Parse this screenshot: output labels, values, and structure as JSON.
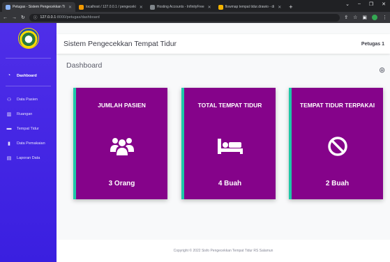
{
  "browser": {
    "tabs": [
      {
        "title": "Petugas - Sistem Pengecekkan Ti",
        "color": "#8ab4f8",
        "active": true
      },
      {
        "title": "localhost / 127.0.0.1 / pengeceki",
        "color": "#f29900",
        "active": false
      },
      {
        "title": "Hosting Accounts - InfinityFree",
        "color": "#80868b",
        "active": false
      },
      {
        "title": "flowmap tempat tidur.drawio - di",
        "color": "#f4b400",
        "active": false
      }
    ],
    "new_tab": "+",
    "url_host": "127.0.0.1",
    "url_path": ":8000/petugas/dashboard"
  },
  "app": {
    "brand": "Sistem Pengecekkan Tempat Tidur",
    "user": "Petugas 1",
    "page_title": "Dashboard"
  },
  "sidebar": {
    "items": [
      {
        "label": "Dashboard",
        "icon": "speedometer-icon",
        "glyph": "◔"
      },
      {
        "label": "Data Pasien",
        "icon": "users-icon",
        "glyph": "⚇"
      },
      {
        "label": "Ruangan",
        "icon": "building-icon",
        "glyph": "▥"
      },
      {
        "label": "Tempat Tidur",
        "icon": "bed-icon",
        "glyph": "▬"
      },
      {
        "label": "Data Pemakaian",
        "icon": "file-icon",
        "glyph": "▮"
      },
      {
        "label": "Laporan Data",
        "icon": "report-icon",
        "glyph": "▤"
      }
    ]
  },
  "cards": [
    {
      "title": "JUMLAH PASIEN",
      "value": "3 Orang",
      "icon": "users-icon"
    },
    {
      "title": "TOTAL TEMPAT TIDUR",
      "value": "4 Buah",
      "icon": "bed-icon"
    },
    {
      "title": "TEMPAT TIDUR TERPAKAI",
      "value": "2 Buah",
      "icon": "ban-icon"
    }
  ],
  "footer": {
    "text": "Copyright © 2022 Sisfo Pengecekkan Tempat Tidur RS Salamun"
  },
  "colors": {
    "sidebar": "#4f2ee8",
    "card": "#85038a",
    "card_accent": "#1ec8a8"
  }
}
